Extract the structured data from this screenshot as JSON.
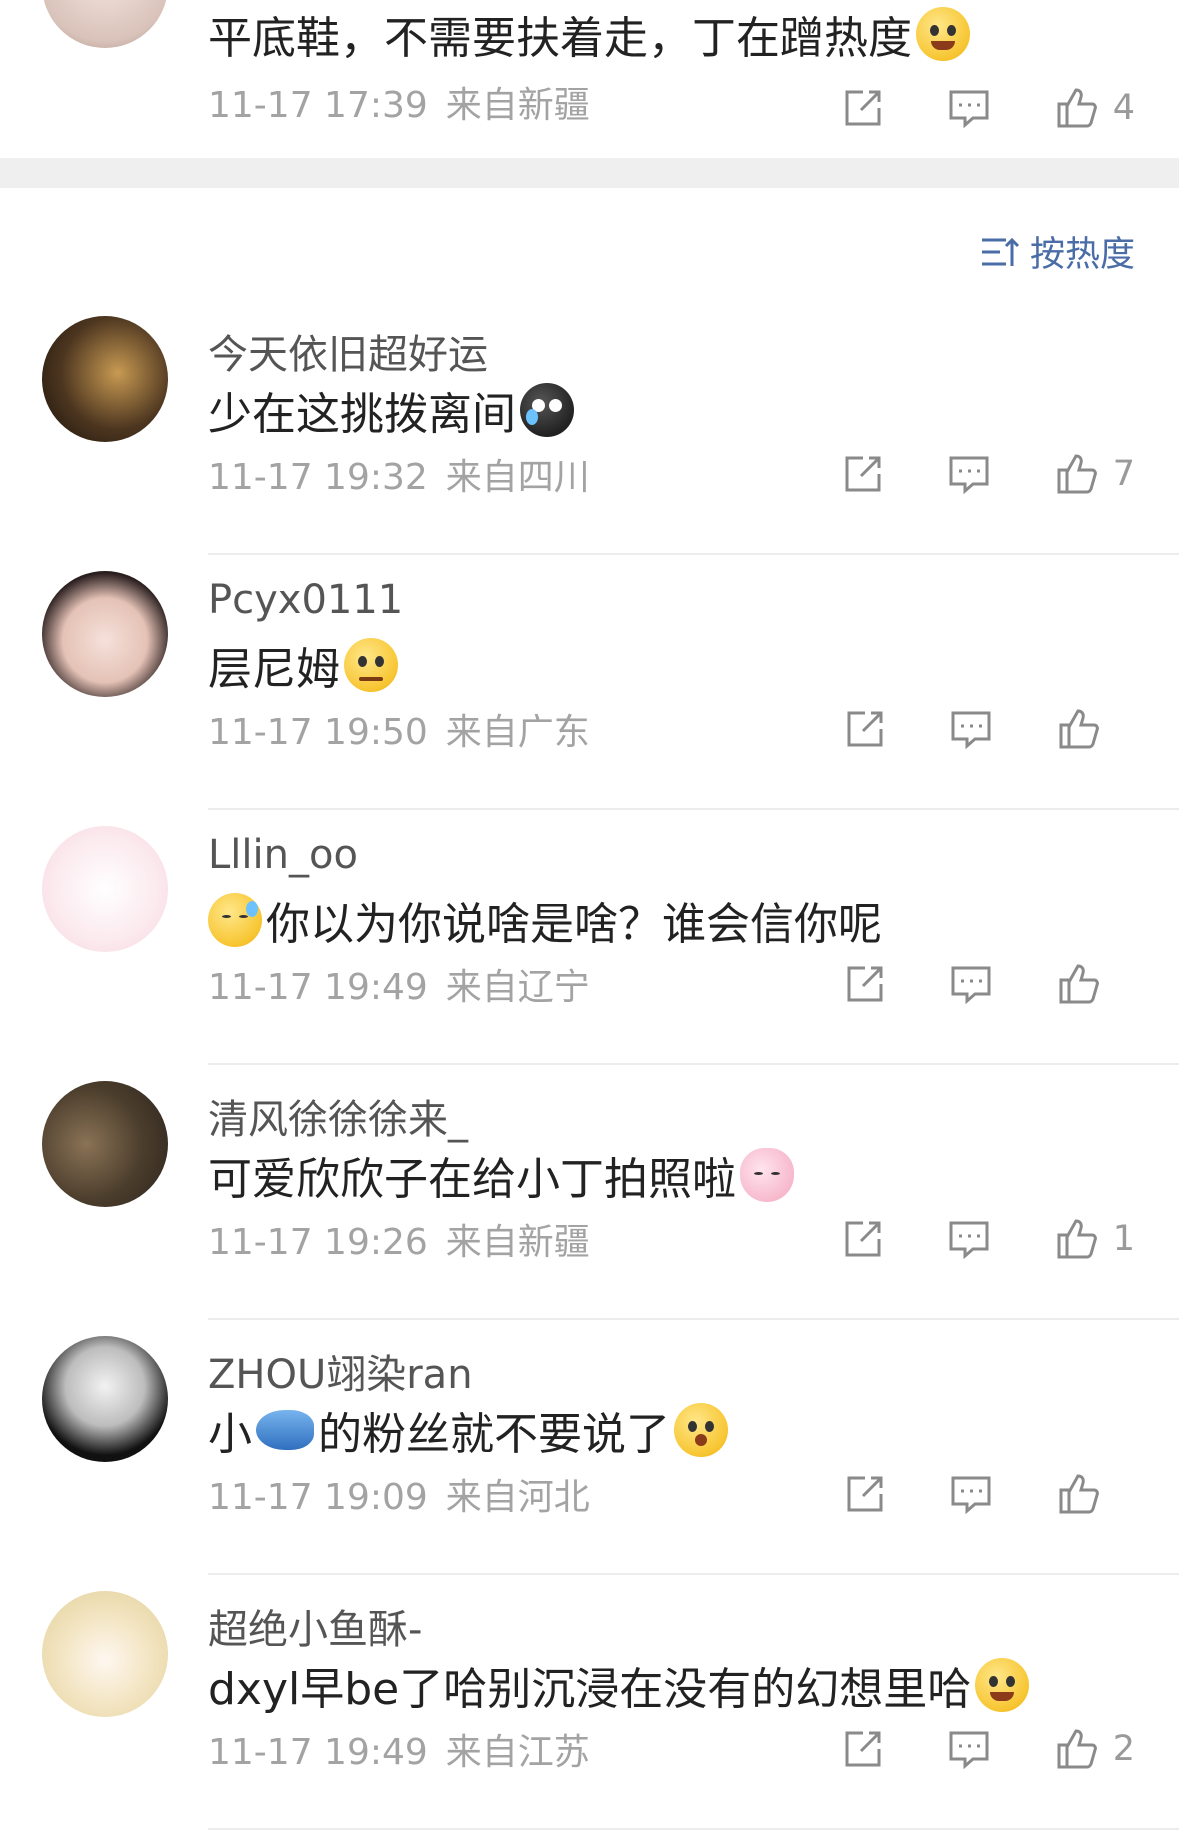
{
  "sort": {
    "label": "按热度"
  },
  "top_comment": {
    "text": "平底鞋，不需要扶着走，丁在蹭热度",
    "time": "11-17 17:39",
    "location": "来自新疆",
    "likes": "4"
  },
  "comments": [
    {
      "name": "今天依旧超好运",
      "text": "少在这挑拨离间",
      "emoji": "crying-dark-emoji",
      "time": "11-17 19:32",
      "location": "来自四川",
      "likes": "7"
    },
    {
      "name": "Pcyx0111",
      "text": "层尼姆",
      "emoji": "pleading-emoji",
      "time": "11-17 19:50",
      "location": "来自广东",
      "likes": ""
    },
    {
      "name": "Lllin_oo",
      "text": "你以为你说啥是啥？谁会信你呢",
      "emoji": "sweat-emoji",
      "time": "11-17 19:49",
      "location": "来自辽宁",
      "likes": ""
    },
    {
      "name": "清风徐徐徐来_",
      "text": "可爱欣欣子在给小丁拍照啦",
      "emoji": "bunny-emoji",
      "time": "11-17 19:26",
      "location": "来自新疆",
      "likes": "1"
    },
    {
      "name": "ZHOU翊染ran",
      "text_before": "小",
      "text": "的粉丝就不要说了",
      "emoji": "fish-emoji",
      "emoji2": "shocked-emoji",
      "time": "11-17 19:09",
      "location": "来自河北",
      "likes": ""
    },
    {
      "name": "超绝小鱼酥-",
      "text": "dxyl早be了哈别沉浸在没有的幻想里哈",
      "emoji": "laughing-crying-emoji",
      "time": "11-17 19:49",
      "location": "来自江苏",
      "likes": "2"
    }
  ],
  "colors": {
    "accent": "#4a6da7",
    "meta": "#a3a3a3",
    "separator": "#efefef"
  }
}
